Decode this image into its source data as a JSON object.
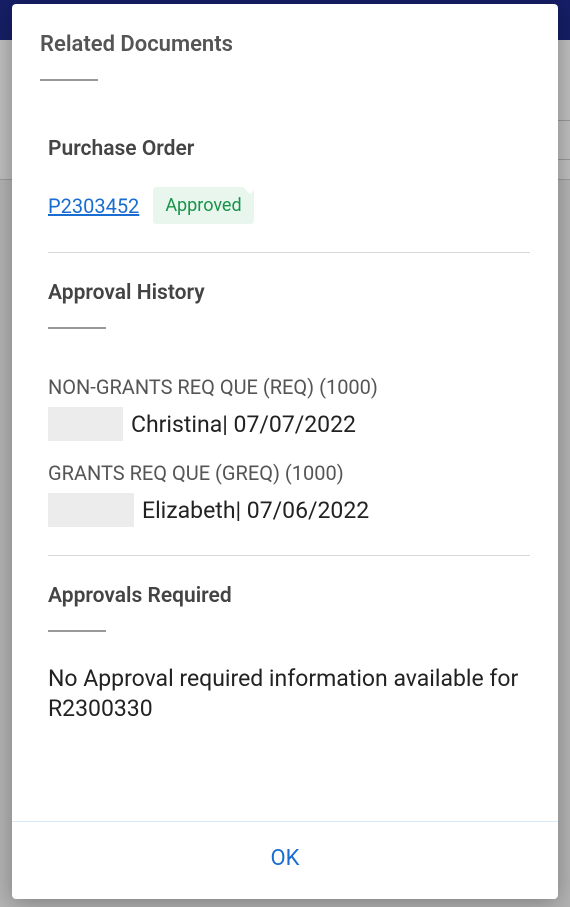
{
  "modal": {
    "title": "Related Documents",
    "ok_label": "OK"
  },
  "purchase_order": {
    "heading": "Purchase Order",
    "number": "P2303452",
    "status": "Approved"
  },
  "approval_history": {
    "heading": "Approval History",
    "items": [
      {
        "queue": "NON-GRANTS REQ QUE (REQ) (1000)",
        "approver": "Christina",
        "date": "07/07/2022",
        "redacted_width": 75
      },
      {
        "queue": "GRANTS REQ QUE (GREQ) (1000)",
        "approver": "Elizabeth",
        "date": "07/06/2022",
        "redacted_width": 86
      }
    ]
  },
  "approvals_required": {
    "heading": "Approvals Required",
    "message": "No Approval required information available for R2300330"
  }
}
